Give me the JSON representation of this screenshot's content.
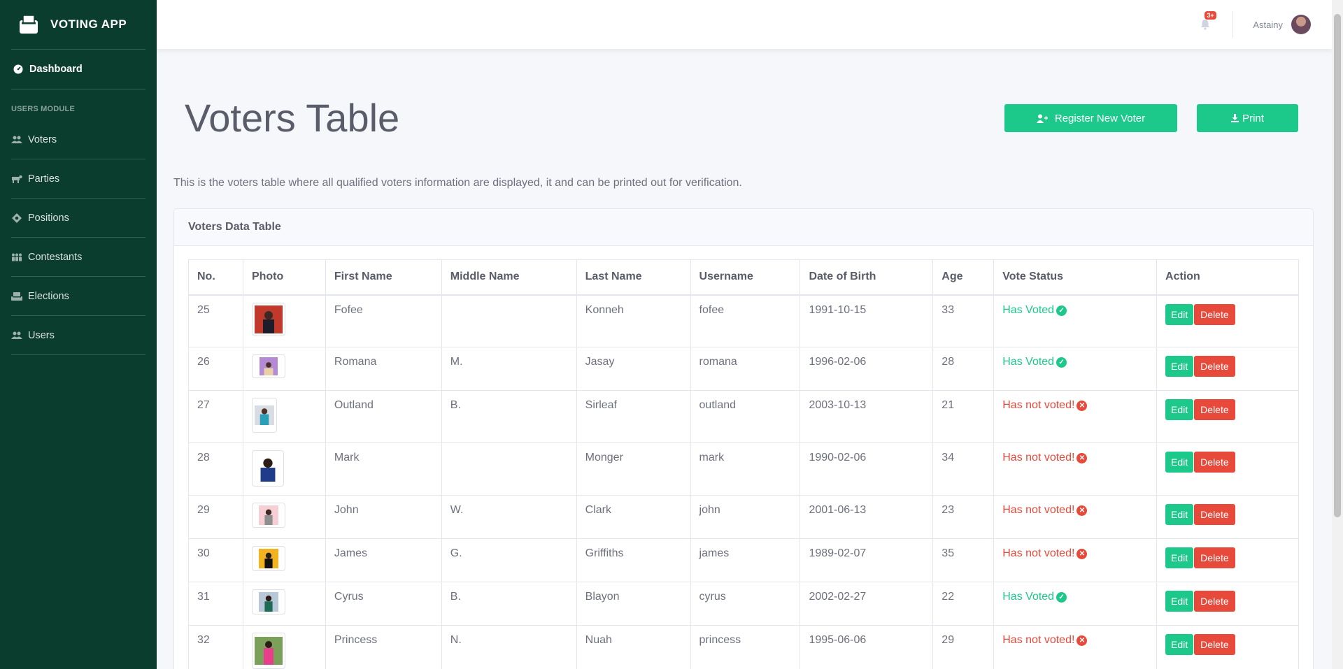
{
  "app": {
    "brand": "VOTING APP"
  },
  "sidebar": {
    "dashboard": {
      "label": "Dashboard",
      "icon": "dashboard-icon"
    },
    "section_heading": "USERS MODULE",
    "items": [
      {
        "label": "Voters",
        "icon": "users-icon"
      },
      {
        "label": "Parties",
        "icon": "party-icon"
      },
      {
        "label": "Positions",
        "icon": "position-icon"
      },
      {
        "label": "Contestants",
        "icon": "contestants-icon"
      },
      {
        "label": "Elections",
        "icon": "ballot-icon"
      },
      {
        "label": "Users",
        "icon": "users-icon"
      }
    ]
  },
  "topbar": {
    "notification_badge": "3+",
    "user_name": "Astainy"
  },
  "page": {
    "title": "Voters Table",
    "register_button": "Register New Voter",
    "print_button": "Print",
    "intro": "This is the voters table where all qualified voters information are displayed, it and can be printed out for verification."
  },
  "card": {
    "title": "Voters Data Table"
  },
  "table": {
    "headers": [
      "No.",
      "Photo",
      "First Name",
      "Middle Name",
      "Last Name",
      "Username",
      "Date of Birth",
      "Age",
      "Vote Status",
      "Action"
    ],
    "edit_label": "Edit",
    "delete_label": "Delete",
    "rows": [
      {
        "no": "25",
        "first": "Fofee",
        "middle": "",
        "last": "Konneh",
        "username": "fofee",
        "dob": "1991-10-15",
        "age": "33",
        "status": "Has Voted",
        "voted": true
      },
      {
        "no": "26",
        "first": "Romana",
        "middle": "M.",
        "last": "Jasay",
        "username": "romana",
        "dob": "1996-02-06",
        "age": "28",
        "status": "Has Voted",
        "voted": true
      },
      {
        "no": "27",
        "first": "Outland",
        "middle": "B.",
        "last": "Sirleaf",
        "username": "outland",
        "dob": "2003-10-13",
        "age": "21",
        "status": "Has not voted!",
        "voted": false
      },
      {
        "no": "28",
        "first": "Mark",
        "middle": "",
        "last": "Monger",
        "username": "mark",
        "dob": "1990-02-06",
        "age": "34",
        "status": "Has not voted!",
        "voted": false
      },
      {
        "no": "29",
        "first": "John",
        "middle": "W.",
        "last": "Clark",
        "username": "john",
        "dob": "2001-06-13",
        "age": "23",
        "status": "Has not voted!",
        "voted": false
      },
      {
        "no": "30",
        "first": "James",
        "middle": "G.",
        "last": "Griffiths",
        "username": "james",
        "dob": "1989-02-07",
        "age": "35",
        "status": "Has not voted!",
        "voted": false
      },
      {
        "no": "31",
        "first": "Cyrus",
        "middle": "B.",
        "last": "Blayon",
        "username": "cyrus",
        "dob": "2002-02-27",
        "age": "22",
        "status": "Has Voted",
        "voted": true
      },
      {
        "no": "32",
        "first": "Princess",
        "middle": "N.",
        "last": "Nuah",
        "username": "princess",
        "dob": "1995-06-06",
        "age": "29",
        "status": "Has not voted!",
        "voted": false
      }
    ]
  },
  "colors": {
    "sidebar": "#0b3d2e",
    "success": "#1cc88a",
    "danger": "#e74a3b"
  }
}
